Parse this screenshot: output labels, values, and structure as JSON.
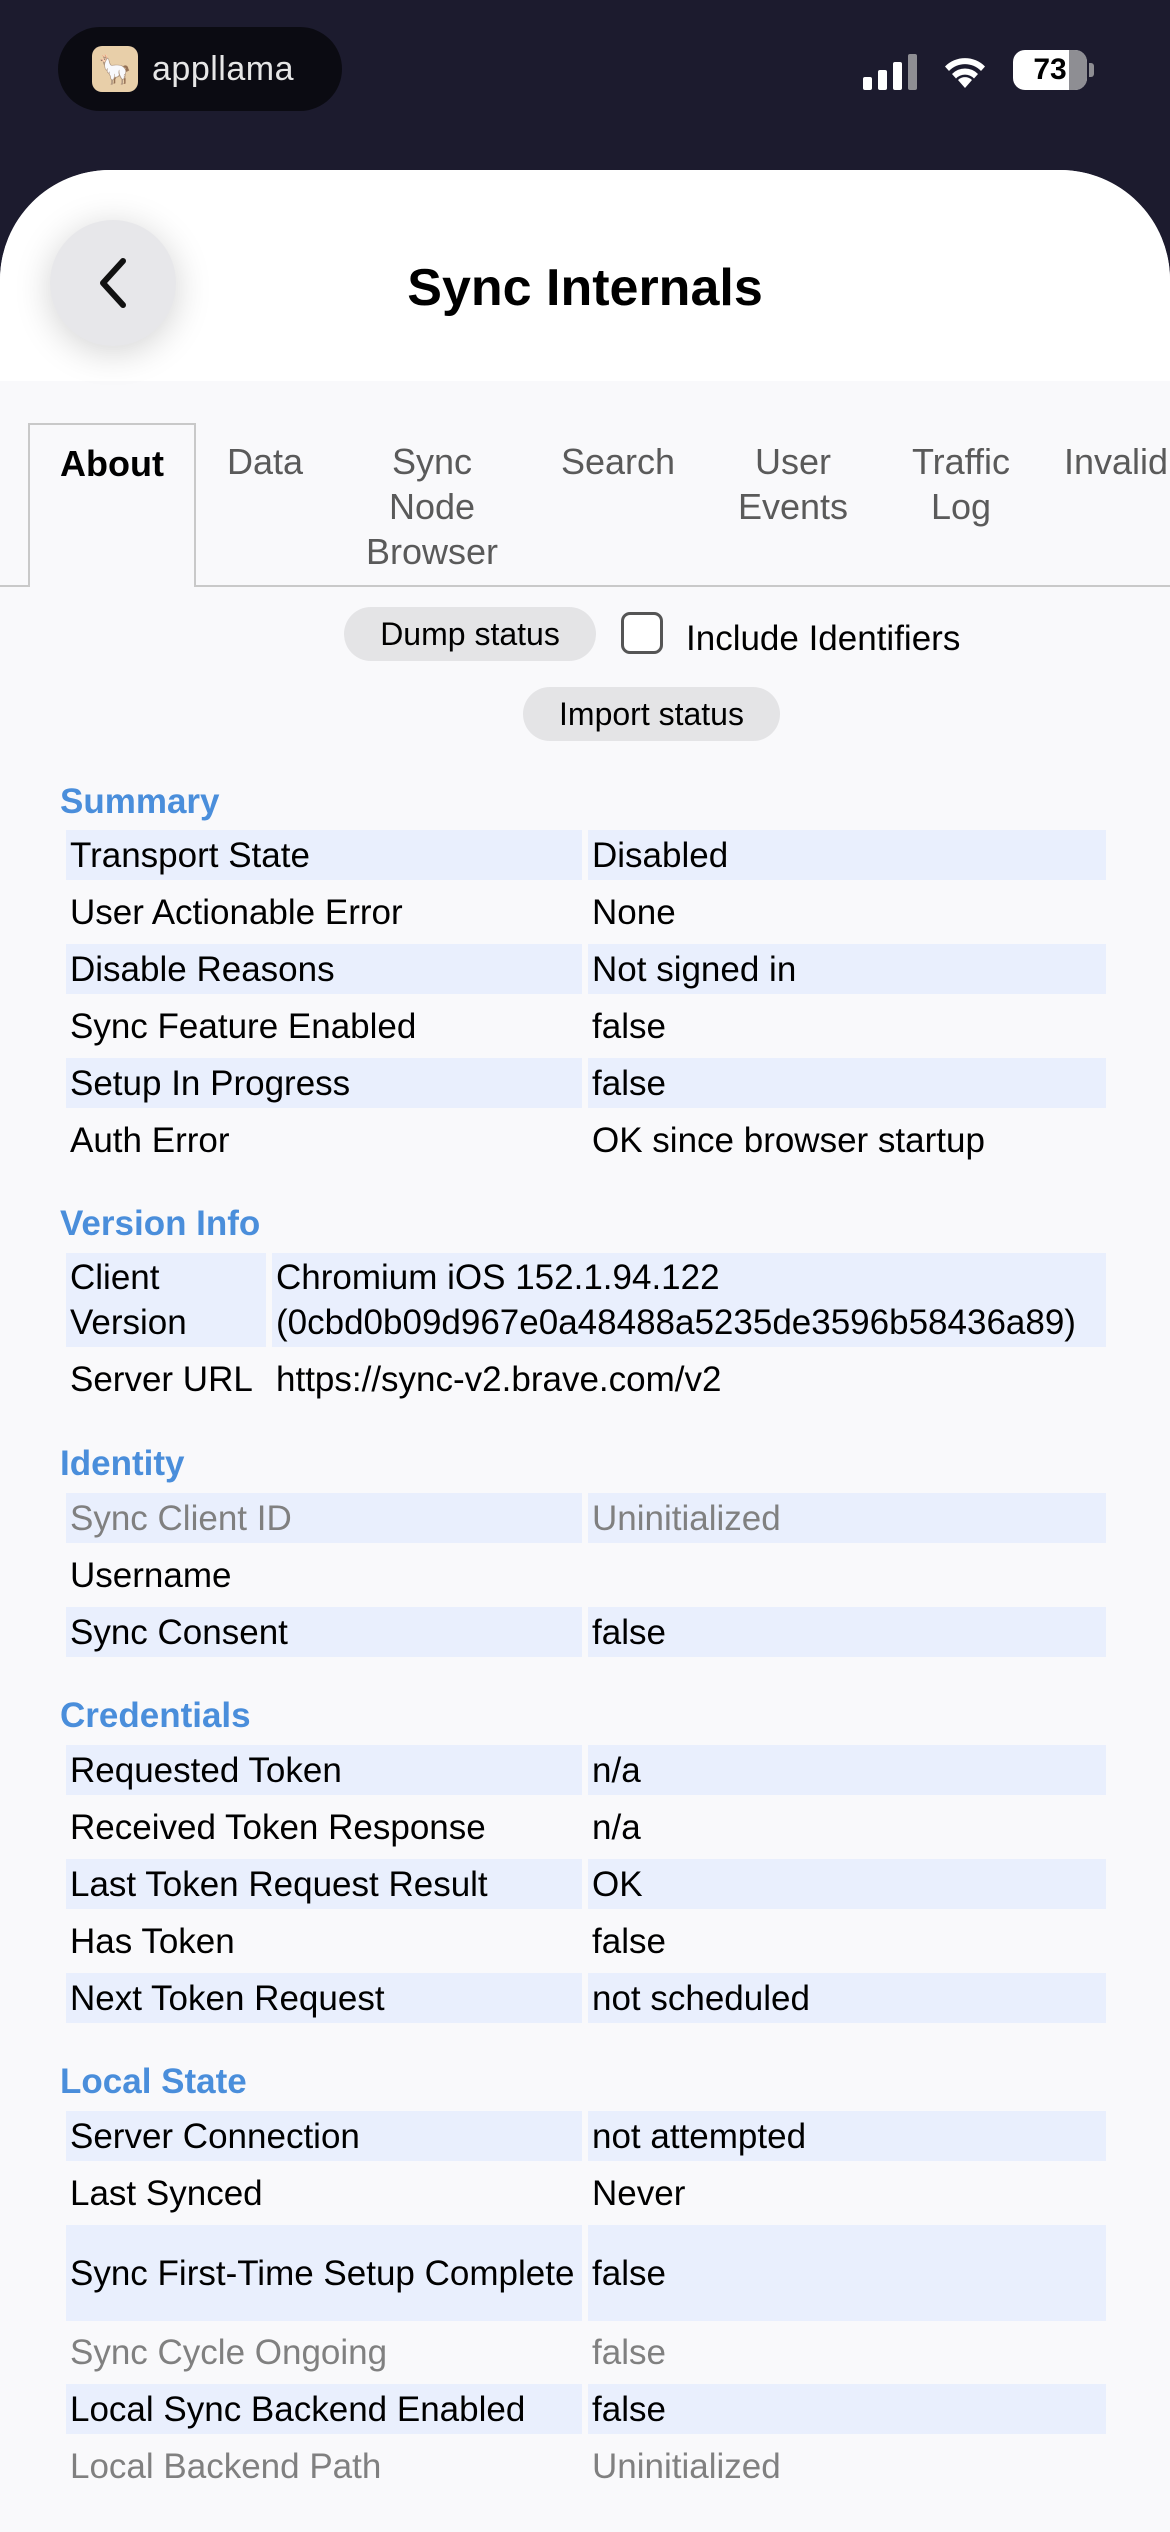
{
  "status_bar": {
    "brand": "appllama",
    "battery": "73"
  },
  "header": {
    "title": "Sync Internals"
  },
  "tabs": [
    {
      "label": "About",
      "active": true
    },
    {
      "label": "Data"
    },
    {
      "label": "Sync Node Browser"
    },
    {
      "label": "Search"
    },
    {
      "label": "User Events"
    },
    {
      "label": "Traffic Log"
    },
    {
      "label": "Invalid"
    }
  ],
  "controls": {
    "dump_status": "Dump status",
    "include_identifiers": "Include Identifiers",
    "import_status": "Import status"
  },
  "summary": {
    "title": "Summary",
    "rows": [
      {
        "key": "Transport State",
        "value": "Disabled"
      },
      {
        "key": "User Actionable Error",
        "value": "None"
      },
      {
        "key": "Disable Reasons",
        "value": "Not signed in"
      },
      {
        "key": "Sync Feature Enabled",
        "value": "false"
      },
      {
        "key": "Setup In Progress",
        "value": "false"
      },
      {
        "key": "Auth Error",
        "value": "OK since browser startup"
      }
    ]
  },
  "version_info": {
    "title": "Version Info",
    "rows": [
      {
        "key": "Client Version",
        "value": "Chromium iOS 152.1.94.122 (0cbd0b09d967e0a48488a5235de3596b58436a89)"
      },
      {
        "key": "Server URL",
        "value": "https://sync-v2.brave.com/v2"
      }
    ]
  },
  "identity": {
    "title": "Identity",
    "rows": [
      {
        "key": "Sync Client ID",
        "value": "Uninitialized"
      },
      {
        "key": "Username",
        "value": ""
      },
      {
        "key": "Sync Consent",
        "value": "false"
      }
    ]
  },
  "credentials": {
    "title": "Credentials",
    "rows": [
      {
        "key": "Requested Token",
        "value": "n/a"
      },
      {
        "key": "Received Token Response",
        "value": "n/a"
      },
      {
        "key": "Last Token Request Result",
        "value": "OK"
      },
      {
        "key": "Has Token",
        "value": "false"
      },
      {
        "key": "Next Token Request",
        "value": "not scheduled"
      }
    ]
  },
  "local_state": {
    "title": "Local State",
    "rows": [
      {
        "key": "Server Connection",
        "value": "not attempted"
      },
      {
        "key": "Last Synced",
        "value": "Never"
      },
      {
        "key": "Sync First-Time Setup Complete",
        "value": "false"
      },
      {
        "key": "Sync Cycle Ongoing",
        "value": "false"
      },
      {
        "key": "Local Sync Backend Enabled",
        "value": "false"
      },
      {
        "key": "Local Backend Path",
        "value": "Uninitialized"
      }
    ]
  },
  "colors": {
    "section_title": "#4a8edb",
    "row_shade": "#e9effd",
    "status_bar_bg": "#1c1b2e"
  }
}
